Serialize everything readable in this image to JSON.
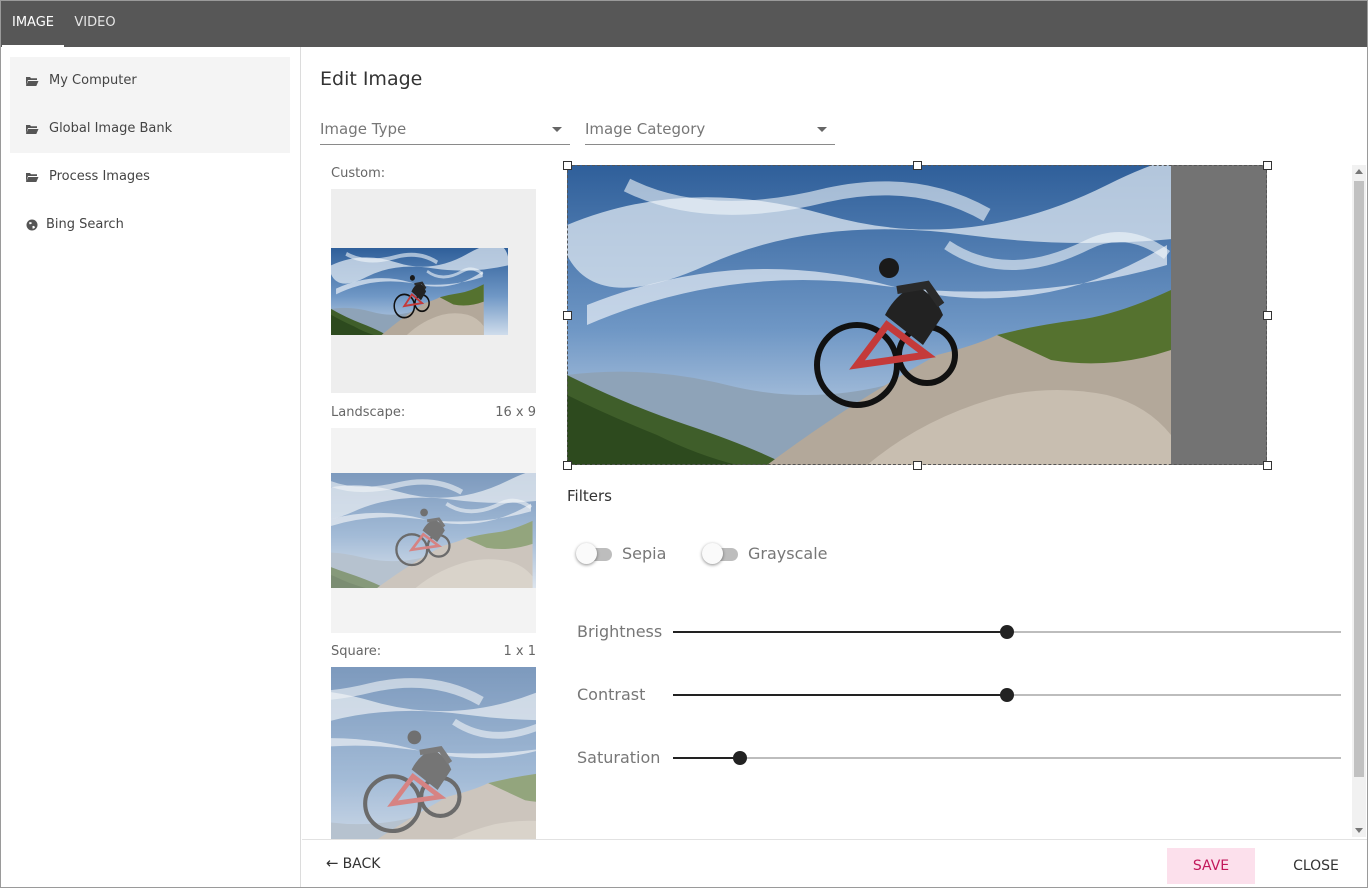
{
  "tabs": [
    {
      "label": "IMAGE",
      "active": true
    },
    {
      "label": "VIDEO",
      "active": false
    }
  ],
  "sidebar": {
    "items": [
      {
        "label": "My Computer",
        "icon": "folder-open-icon"
      },
      {
        "label": "Global Image Bank",
        "icon": "folder-open-icon"
      },
      {
        "label": "Process Images",
        "icon": "folder-open-icon"
      },
      {
        "label": "Bing Search",
        "icon": "globe-icon"
      }
    ]
  },
  "main": {
    "title": "Edit Image",
    "image_type": {
      "value": "Image Type"
    },
    "image_category": {
      "value": "Image Category"
    }
  },
  "thumbnails": [
    {
      "label": "Custom:",
      "ratio": ""
    },
    {
      "label": "Landscape:",
      "ratio": "16 x 9"
    },
    {
      "label": "Square:",
      "ratio": "1 x 1"
    }
  ],
  "filters": {
    "title": "Filters",
    "toggles": [
      {
        "label": "Sepia",
        "on": false
      },
      {
        "label": "Grayscale",
        "on": false
      }
    ],
    "sliders": [
      {
        "label": "Brightness",
        "value": 0.5
      },
      {
        "label": "Contrast",
        "value": 0.5
      },
      {
        "label": "Saturation",
        "value": 0.1
      }
    ]
  },
  "footer": {
    "back_label": "BACK",
    "save_label": "SAVE",
    "close_label": "CLOSE"
  },
  "colors": {
    "topbar": "#575757",
    "save_bg": "#fce0ec",
    "save_text": "#c2185b",
    "slider_active": "#222222"
  }
}
